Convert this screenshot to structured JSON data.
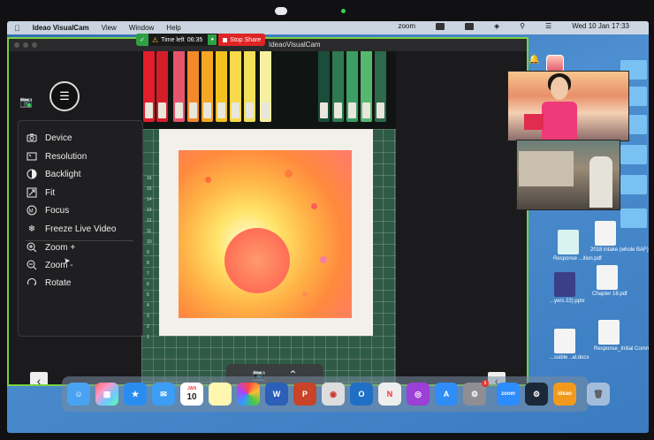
{
  "menubar": {
    "app_name": "Ideao VisualCam",
    "items": [
      "View",
      "Window",
      "Help"
    ],
    "right": {
      "zoom": "zoom",
      "datetime": "Wed 10 Jan  17:33"
    }
  },
  "share_bar": {
    "time_left_label": "Time left",
    "time_value": "06:35",
    "stop_label": "Stop Share"
  },
  "window": {
    "title": "IdeaoVisualCam"
  },
  "menu": {
    "items": [
      {
        "label": "Device",
        "icon": "camera-icon"
      },
      {
        "label": "Resolution",
        "icon": "resolution-icon"
      },
      {
        "label": "Backlight",
        "icon": "backlight-icon"
      },
      {
        "label": "Fit",
        "icon": "fit-icon"
      },
      {
        "label": "Focus",
        "icon": "focus-icon"
      },
      {
        "label": "Freeze Live Video",
        "icon": "snowflake-icon"
      },
      {
        "label": "Zoom +",
        "icon": "zoom-in-icon"
      },
      {
        "label": "Zoom -",
        "icon": "zoom-out-icon"
      },
      {
        "label": "Rotate",
        "icon": "rotate-icon"
      }
    ]
  },
  "ruler": {
    "numbers": [
      "16",
      "15",
      "14",
      "13",
      "12",
      "11",
      "10",
      "9",
      "8",
      "7",
      "6",
      "5",
      "4",
      "3",
      "2",
      "1"
    ]
  },
  "desktop_files": {
    "f1": "2018 intake (whole BAF)",
    "f2": "Response ...ition.pdf",
    "f3": "...yers 22).pptx",
    "f4": "Chapter 18.pdf",
    "f5": "...ssible ..al.docx",
    "f6": "Response_Initial Comme..._VTC.pdf"
  },
  "dock": {
    "calendar_month": "JAN",
    "calendar_day": "10",
    "settings_badge": "1",
    "zoom_label": "zoom",
    "ideao_label": "ideao"
  }
}
